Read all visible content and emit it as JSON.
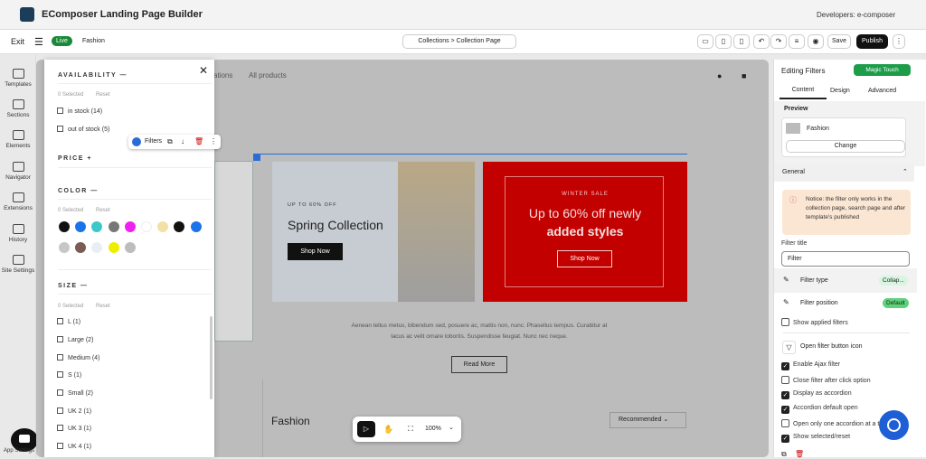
{
  "app": {
    "title": "EComposer Landing Page Builder",
    "developers": "Developers: e-composer"
  },
  "toolbar": {
    "exit": "Exit",
    "status": "Live",
    "page": "Fashion",
    "collection": "Collections > Collection Page",
    "save": "Save",
    "publish": "Publish"
  },
  "leftnav": [
    {
      "label": "Templates",
      "icon": "templates-icon"
    },
    {
      "label": "Sections",
      "icon": "sections-icon"
    },
    {
      "label": "Elements",
      "icon": "elements-icon"
    },
    {
      "label": "Navigator",
      "icon": "navigator-icon"
    },
    {
      "label": "Extensions",
      "icon": "extensions-icon"
    },
    {
      "label": "History",
      "icon": "history-icon"
    },
    {
      "label": "Site Settings",
      "icon": "settings-icon"
    }
  ],
  "store_nav": {
    "collections": "ations",
    "all": "All products"
  },
  "filters": {
    "availability": {
      "title": "AVAILABILITY",
      "selected": "0 Selected",
      "reset": "Reset",
      "options": [
        "in stock (14)",
        "out of stock (5)"
      ]
    },
    "price": {
      "title": "PRICE"
    },
    "color": {
      "title": "COLOR",
      "selected": "0 Selected",
      "reset": "Reset",
      "colors": [
        "#111111",
        "#1a73e8",
        "#3cc8c8",
        "#777777",
        "#ee22ee",
        "#ffffff",
        "#f3e0a6",
        "#111111",
        "#1a73e8",
        "#c7c7c7",
        "#7a5c55",
        "#e8eef5",
        "#eeee00",
        "#bdbdbd"
      ]
    },
    "size": {
      "title": "SIZE",
      "selected": "0 Selected",
      "reset": "Reset",
      "options": [
        "L (1)",
        "Large (2)",
        "Medium (4)",
        "S (1)",
        "Small (2)",
        "UK 2 (1)",
        "UK 3 (1)",
        "UK 4 (1)"
      ]
    }
  },
  "float_tool": {
    "label": "Filters"
  },
  "banner1": {
    "kicker": "UP TO 60% OFF",
    "title": "Spring Collection",
    "cta": "Shop Now"
  },
  "banner2": {
    "kicker": "WINTER SALE",
    "title": "Up to 60% off newly",
    "title2": "added styles",
    "cta": "Shop Now"
  },
  "description": {
    "text1": "Aenean tellus metus, bibendum sed, posuere ac, mattis non, nunc. Phasellus tempus. Curabitur at",
    "text2": "lacus ac velit ornare lobortis. Suspendisse feugiat. Nunc nec neque.",
    "cta": "Read More"
  },
  "fashion": {
    "title": "Fashion",
    "sort": "Recommended"
  },
  "canvas_tools": {
    "zoom": "100%"
  },
  "right": {
    "title": "Editing Filters",
    "magic": "Magic Touch",
    "tabs": [
      "Content",
      "Design",
      "Advanced"
    ],
    "preview_label": "Preview",
    "preview_name": "Fashion",
    "change": "Change",
    "general": "General",
    "notice": "Notice: the filter only works in the collection page, search page and after template's published",
    "filter_title_label": "Filter title",
    "filter_title_value": "Filter",
    "filter_type": "Filter type",
    "filter_type_badge": "Collap...",
    "filter_position": "Filter position",
    "filter_position_badge": "Default",
    "show_applied": "Show applied filters",
    "open_icon": "Open filter button icon",
    "toggles": [
      {
        "label": "Enable Ajax filter",
        "on": true
      },
      {
        "label": "Close filter after click option",
        "on": false
      },
      {
        "label": "Display as accordion",
        "on": true
      },
      {
        "label": "Accordion default open",
        "on": true
      },
      {
        "label": "Open only one accordion at a ti",
        "on": false
      },
      {
        "label": "Show selected/reset",
        "on": true
      }
    ]
  },
  "app_settings": "App Settings",
  "colors": {
    "accent": "#1a8a3a",
    "red": "#c30000",
    "magic": "#1d9d4a"
  }
}
